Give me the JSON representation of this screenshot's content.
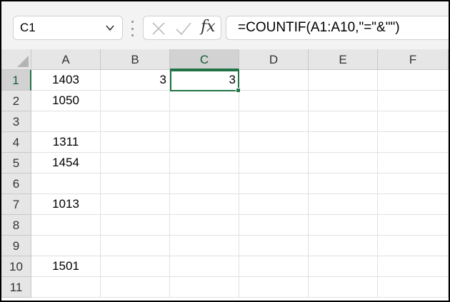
{
  "name_box": {
    "value": "C1"
  },
  "formula_bar": {
    "cancel_icon": "cancel-x-icon",
    "enter_icon": "enter-check-icon",
    "fx_label": "fx",
    "formula": "=COUNTIF(A1:A10,\"=\"&\"\")"
  },
  "columns": [
    "A",
    "B",
    "C",
    "D",
    "E",
    "F"
  ],
  "selected_column": "C",
  "rows": [
    {
      "num": "1",
      "A": "1403",
      "B": "3",
      "C": "3"
    },
    {
      "num": "2",
      "A": "1050",
      "B": "",
      "C": ""
    },
    {
      "num": "3",
      "A": "",
      "B": "",
      "C": ""
    },
    {
      "num": "4",
      "A": "1311",
      "B": "",
      "C": ""
    },
    {
      "num": "5",
      "A": "1454",
      "B": "",
      "C": ""
    },
    {
      "num": "6",
      "A": "",
      "B": "",
      "C": ""
    },
    {
      "num": "7",
      "A": "1013",
      "B": "",
      "C": ""
    },
    {
      "num": "8",
      "A": "",
      "B": "",
      "C": ""
    },
    {
      "num": "9",
      "A": "",
      "B": "",
      "C": ""
    },
    {
      "num": "10",
      "A": "1501",
      "B": "",
      "C": ""
    },
    {
      "num": "11",
      "A": "",
      "B": "",
      "C": ""
    }
  ],
  "selected_row": "1",
  "colors": {
    "selection": "#217346",
    "header_bg": "#e6e6e6",
    "header_selected_bg": "#d2d2d2"
  }
}
